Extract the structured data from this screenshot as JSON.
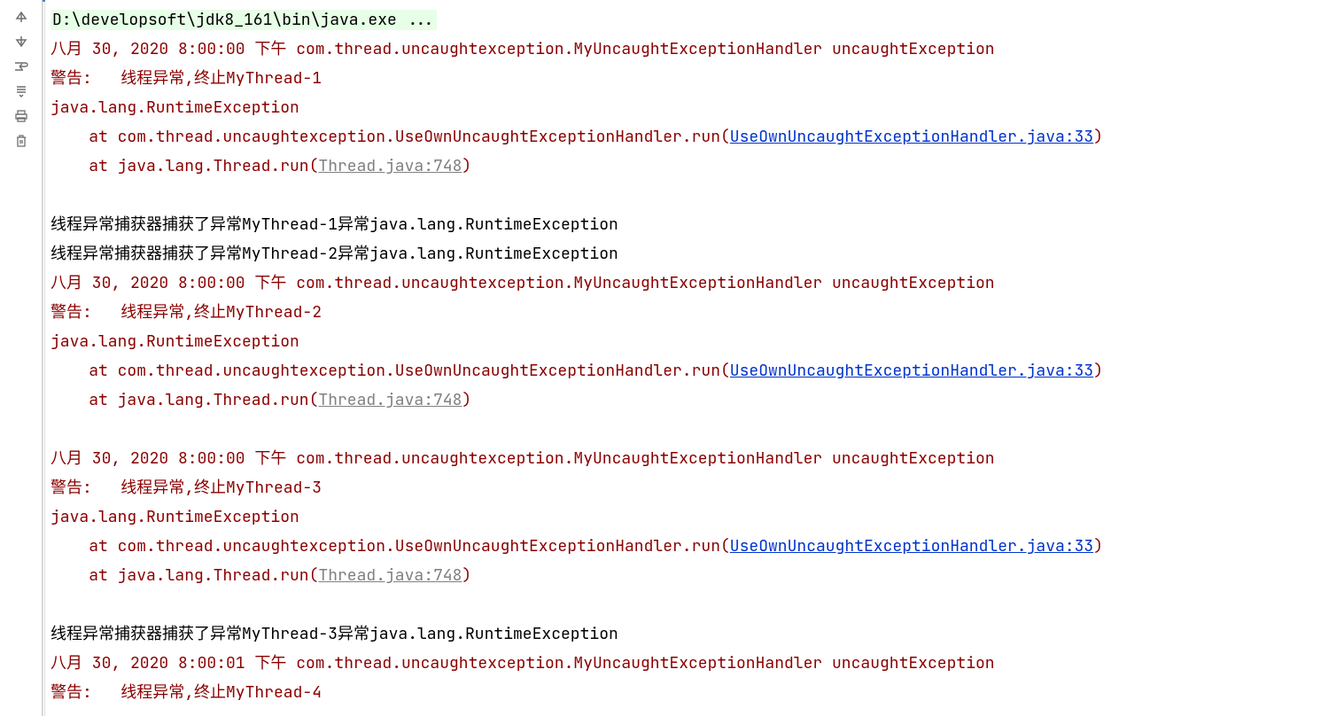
{
  "command": "D:\\developsoft\\jdk8_161\\bin\\java.exe ...",
  "blocks": [
    {
      "type": "err",
      "indent": 0,
      "text": "八月 30, 2020 8:00:00 下午 com.thread.uncaughtexception.MyUncaughtExceptionHandler uncaughtException"
    },
    {
      "type": "err",
      "indent": 0,
      "text": "警告:   线程异常,终止MyThread-1"
    },
    {
      "type": "err",
      "indent": 0,
      "text": "java.lang.RuntimeException"
    },
    {
      "type": "err-trace",
      "indent": 1,
      "prefix": "at com.thread.uncaughtexception.UseOwnUncaughtExceptionHandler.run(",
      "link": "UseOwnUncaughtExceptionHandler.java:33",
      "linkClass": "link",
      "suffix": ")"
    },
    {
      "type": "err-trace",
      "indent": 1,
      "prefix": "at java.lang.Thread.run(",
      "link": "Thread.java:748",
      "linkClass": "link-dis",
      "suffix": ")"
    },
    {
      "type": "blank"
    },
    {
      "type": "std",
      "indent": 0,
      "text": "线程异常捕获器捕获了异常MyThread-1异常java.lang.RuntimeException"
    },
    {
      "type": "std",
      "indent": 0,
      "text": "线程异常捕获器捕获了异常MyThread-2异常java.lang.RuntimeException"
    },
    {
      "type": "err",
      "indent": 0,
      "text": "八月 30, 2020 8:00:00 下午 com.thread.uncaughtexception.MyUncaughtExceptionHandler uncaughtException"
    },
    {
      "type": "err",
      "indent": 0,
      "text": "警告:   线程异常,终止MyThread-2"
    },
    {
      "type": "err",
      "indent": 0,
      "text": "java.lang.RuntimeException"
    },
    {
      "type": "err-trace",
      "indent": 1,
      "prefix": "at com.thread.uncaughtexception.UseOwnUncaughtExceptionHandler.run(",
      "link": "UseOwnUncaughtExceptionHandler.java:33",
      "linkClass": "link",
      "suffix": ")"
    },
    {
      "type": "err-trace",
      "indent": 1,
      "prefix": "at java.lang.Thread.run(",
      "link": "Thread.java:748",
      "linkClass": "link-dis",
      "suffix": ")"
    },
    {
      "type": "blank"
    },
    {
      "type": "err",
      "indent": 0,
      "text": "八月 30, 2020 8:00:00 下午 com.thread.uncaughtexception.MyUncaughtExceptionHandler uncaughtException"
    },
    {
      "type": "err",
      "indent": 0,
      "text": "警告:   线程异常,终止MyThread-3"
    },
    {
      "type": "err",
      "indent": 0,
      "text": "java.lang.RuntimeException"
    },
    {
      "type": "err-trace",
      "indent": 1,
      "prefix": "at com.thread.uncaughtexception.UseOwnUncaughtExceptionHandler.run(",
      "link": "UseOwnUncaughtExceptionHandler.java:33",
      "linkClass": "link",
      "suffix": ")"
    },
    {
      "type": "err-trace",
      "indent": 1,
      "prefix": "at java.lang.Thread.run(",
      "link": "Thread.java:748",
      "linkClass": "link-dis",
      "suffix": ")"
    },
    {
      "type": "blank"
    },
    {
      "type": "std",
      "indent": 0,
      "text": "线程异常捕获器捕获了异常MyThread-3异常java.lang.RuntimeException"
    },
    {
      "type": "err",
      "indent": 0,
      "text": "八月 30, 2020 8:00:01 下午 com.thread.uncaughtexception.MyUncaughtExceptionHandler uncaughtException"
    },
    {
      "type": "err",
      "indent": 0,
      "text": "警告:   线程异常,终止MyThread-4"
    }
  ],
  "toolbar": {
    "up": "↑",
    "down": "↓",
    "wrap": "↩",
    "scrollEnd": "⤓",
    "print": "🖨",
    "trash": "🗑"
  }
}
